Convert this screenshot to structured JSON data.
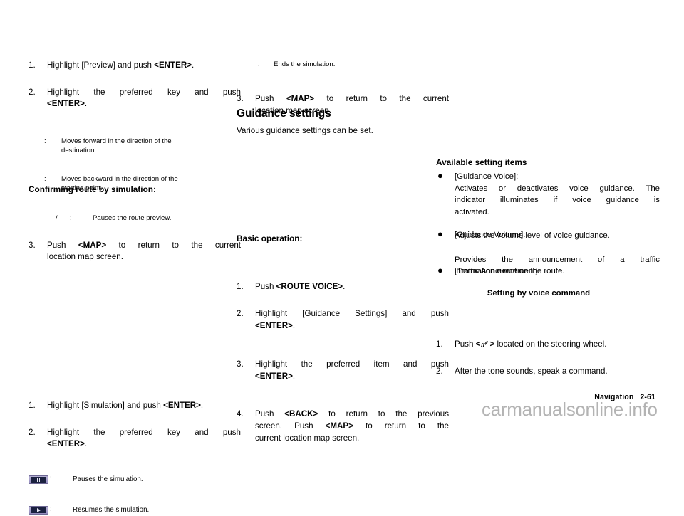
{
  "document": {
    "footer_section": "Navigation",
    "footer_page": "2-61",
    "watermark": "carmanualsonline.info"
  },
  "left_column": {
    "step1": {
      "num": "1.",
      "text_a": "Highlight [Preview] and push ",
      "text_b": "<ENTER>",
      "text_c": "."
    },
    "step2": {
      "num": "2.",
      "line1": "Highlight the preferred key and push",
      "text_b": "<ENTER>",
      "text_c": "."
    },
    "defs": [
      {
        "key": ":",
        "line1": "Moves forward in the direction of the",
        "line2": "destination."
      },
      {
        "key": ":",
        "line1": "Moves backward in the direction of the",
        "line2": "starting point."
      },
      {
        "key_slash": "/",
        "key": ":",
        "line1": "Pauses the route preview."
      }
    ],
    "step3": {
      "num": "3.",
      "text_a": "Push ",
      "text_b": "<MAP>",
      "text_c": " to return to the current",
      "line2": "location map screen."
    },
    "heading_confirm": "Confirming route by simulation:",
    "sim_step1": {
      "num": "1.",
      "text_a": "Highlight [Simulation] and push ",
      "text_b": "<ENTER>",
      "text_c": "."
    },
    "sim_step2": {
      "num": "2.",
      "line1": "Highlight the preferred key and push",
      "text_b": "<ENTER>",
      "text_c": "."
    },
    "icon_rows": [
      {
        "icon": "pause-button-icon",
        "colon": ":",
        "text": "Pauses the simulation."
      },
      {
        "icon": "play-button-icon",
        "colon": ":",
        "text": "Resumes the simulation."
      }
    ]
  },
  "middle_column": {
    "def_end": {
      "key": ":",
      "text": "Ends the simulation."
    },
    "step3": {
      "num": "3.",
      "text_a": "Push ",
      "text_b": "<MAP>",
      "text_c": " to return to the current",
      "line2": "location map screen."
    },
    "heading_guidance": "Guidance settings",
    "intro": "Various guidance settings can be set.",
    "heading_basic": "Basic operation:",
    "steps": [
      {
        "num": "1.",
        "text_a": "Push ",
        "text_b": "<ROUTE VOICE>",
        "text_c": "."
      },
      {
        "num": "2.",
        "line1": "Highlight [Guidance Settings] and push",
        "text_b": "<ENTER>",
        "text_c": "."
      },
      {
        "num": "3.",
        "line1": "Highlight the preferred item and push",
        "text_b": "<ENTER>",
        "text_c": "."
      },
      {
        "num": "4.",
        "text_a": "Push ",
        "text_b": "<BACK>",
        "text_c": " to return to the previous",
        "line2_a": "screen. Push ",
        "line2_b": "<MAP>",
        "line2_c": " to return to the",
        "line3": "current location map screen."
      }
    ]
  },
  "right_column": {
    "heading_available": "Available setting items",
    "items": [
      {
        "bullet": "●",
        "label": "[Guidance Voice]:",
        "desc_line1": "Activates or deactivates voice guidance. The",
        "desc_line2": "indicator illuminates if voice guidance is",
        "desc_line3": "activated."
      },
      {
        "bullet": "●",
        "label": "[Guidance Volume]:",
        "desc_line1": "Adjusts the volume level of voice guidance."
      },
      {
        "bullet": "●",
        "label": "[Traffic Announcement]:",
        "desc_line1": "Provides the announcement of a traffic",
        "desc_line2": "information event on the route."
      }
    ],
    "heading_voice": "Setting by voice command",
    "voice_steps": [
      {
        "num": "1.",
        "text_a": "Push ",
        "bracket_open": "<",
        "icon": "voice-command-icon",
        "bracket_close": ">",
        "text_c": " located on the steering wheel."
      },
      {
        "num": "2.",
        "text_a": "After the tone sounds, speak a command."
      }
    ]
  }
}
